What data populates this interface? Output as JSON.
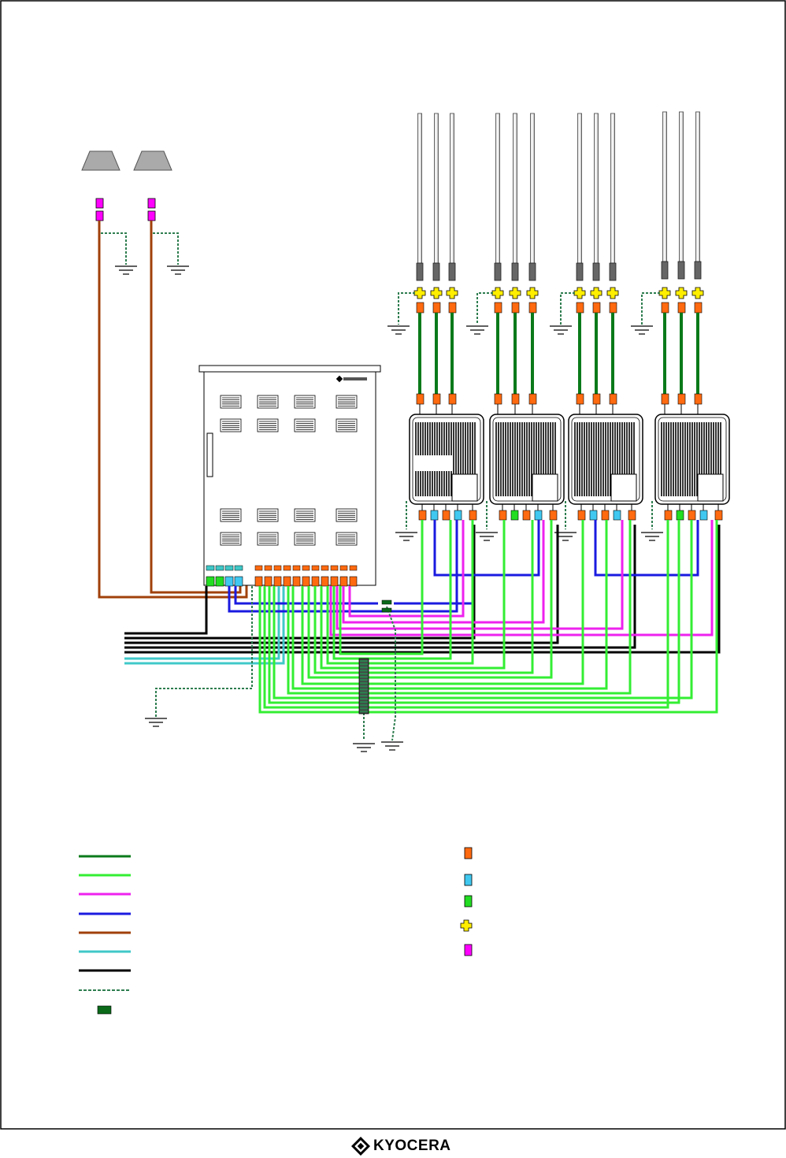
{
  "brand": {
    "name": "KYOCERA",
    "logo_icon": "kyocera-logo-icon"
  },
  "colors": {
    "rf_cable": "#0a7a1a",
    "data_cable": "#33ee33",
    "pink_cable": "#ee22ee",
    "blue_cable": "#1a1ae0",
    "brown_cable": "#a0400a",
    "cyan_cable": "#40c8c8",
    "black_cable": "#000000",
    "ground_wire": "#2e7d4f",
    "orange_connector": "#ff6a10",
    "cyan_connector": "#40c8f0",
    "green_connector": "#22dd22",
    "yellow_connector": "#ffee00",
    "magenta_connector": "#ff00ff",
    "ground_block": "#0a6a1a"
  },
  "legend": {
    "lines": [
      {
        "name": "rf-cable",
        "color": "#0a7a1a",
        "style": "solid"
      },
      {
        "name": "data-cable",
        "color": "#33ee33",
        "style": "solid"
      },
      {
        "name": "pink-cable",
        "color": "#ee22ee",
        "style": "solid"
      },
      {
        "name": "blue-cable",
        "color": "#1a1ae0",
        "style": "solid"
      },
      {
        "name": "brown-cable",
        "color": "#a0400a",
        "style": "solid"
      },
      {
        "name": "cyan-cable",
        "color": "#40c8c8",
        "style": "solid"
      },
      {
        "name": "black-cable",
        "color": "#000000",
        "style": "solid"
      },
      {
        "name": "ground-wire",
        "color": "#2e7d4f",
        "style": "dashed"
      },
      {
        "name": "ground-block",
        "color": "#0a6a1a",
        "style": "block"
      }
    ],
    "connectors": [
      {
        "name": "orange-connector",
        "color": "#ff6a10",
        "shape": "rect"
      },
      {
        "name": "cyan-connector",
        "color": "#40c8f0",
        "shape": "rect"
      },
      {
        "name": "green-connector",
        "color": "#22dd22",
        "shape": "rect"
      },
      {
        "name": "yellow-connector",
        "color": "#ffee00",
        "shape": "cross"
      },
      {
        "name": "magenta-connector",
        "color": "#ff00ff",
        "shape": "rect"
      }
    ]
  }
}
